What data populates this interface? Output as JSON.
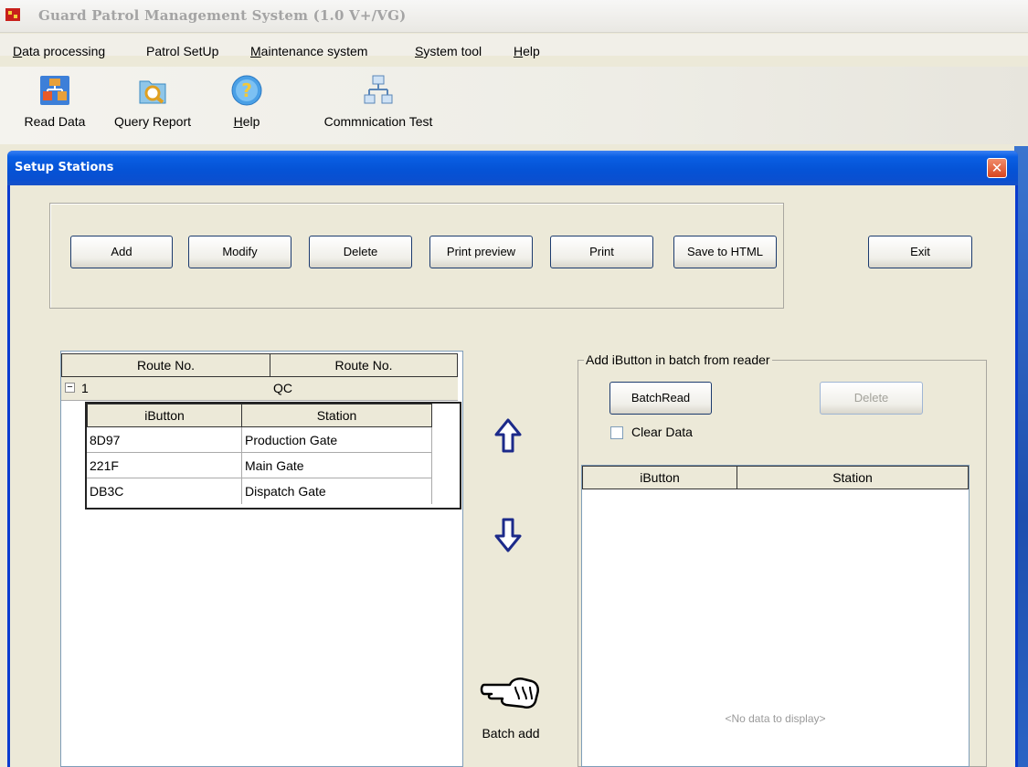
{
  "app": {
    "title": "Guard Patrol Management System (1.0 V+/VG)"
  },
  "menu": [
    {
      "pre": "",
      "u": "D",
      "post": "ata processing"
    },
    {
      "pre": "Patrol SetUp",
      "u": "",
      "post": ""
    },
    {
      "pre": "",
      "u": "M",
      "post": "aintenance system"
    },
    {
      "pre": "",
      "u": "S",
      "post": "ystem tool"
    },
    {
      "pre": "",
      "u": "H",
      "post": "elp"
    }
  ],
  "toolbar": {
    "read_data": "Read Data",
    "query_report": "Query Report",
    "help_pre": "",
    "help_u": "H",
    "help_post": "elp",
    "comm_test": "Commnication Test"
  },
  "window": {
    "title": "Setup Stations",
    "close_glyph": "✕"
  },
  "actions": {
    "add": "Add",
    "modify": "Modify",
    "delete": "Delete",
    "print_preview": "Print preview",
    "print": "Print",
    "save_html": "Save to HTML",
    "exit": "Exit"
  },
  "route_grid": {
    "headers": [
      "Route No.",
      "Route No."
    ],
    "group_toggle": "−",
    "group": {
      "route_no": "1",
      "route_name": "QC"
    },
    "sub_headers": [
      "iButton",
      "Station"
    ],
    "rows": [
      {
        "ibutton": "8D97",
        "station": "Production Gate"
      },
      {
        "ibutton": "221F",
        "station": "Main Gate"
      },
      {
        "ibutton": "DB3C",
        "station": "Dispatch Gate"
      }
    ]
  },
  "batch": {
    "label": "Batch add"
  },
  "reader": {
    "group_title": "Add iButton in batch from reader",
    "batch_read": "BatchRead",
    "delete": "Delete",
    "clear_data": "Clear Data",
    "clear_checked": false,
    "headers": [
      "iButton",
      "Station"
    ],
    "empty": "<No data to display>"
  }
}
